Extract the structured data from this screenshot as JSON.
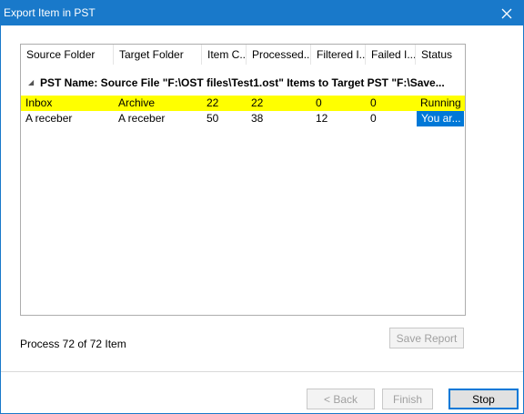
{
  "window": {
    "title": "Export Item in PST"
  },
  "grid": {
    "columns": [
      "Source Folder",
      "Target Folder",
      "Item C...",
      "Processed...",
      "Filtered I...",
      "Failed I...",
      "Status"
    ],
    "group_header": "PST Name: Source File \"F:\\OST files\\Test1.ost\" Items to Target PST \"F:\\Save...",
    "rows": [
      {
        "source": "Inbox",
        "target": "Archive",
        "item_count": "22",
        "processed": "22",
        "filtered": "0",
        "failed": "0",
        "status": "Running"
      },
      {
        "source": "A receber",
        "target": "A receber",
        "item_count": "50",
        "processed": "38",
        "filtered": "12",
        "failed": "0",
        "status": "You ar..."
      }
    ]
  },
  "process_label": "Process 72 of 72 Item",
  "buttons": {
    "save_report": "Save Report",
    "back": "< Back",
    "finish": "Finish",
    "stop": "Stop"
  },
  "colors": {
    "title_bar": "#1979ca",
    "running_highlight": "#ffff00",
    "selection": "#0078d7"
  }
}
